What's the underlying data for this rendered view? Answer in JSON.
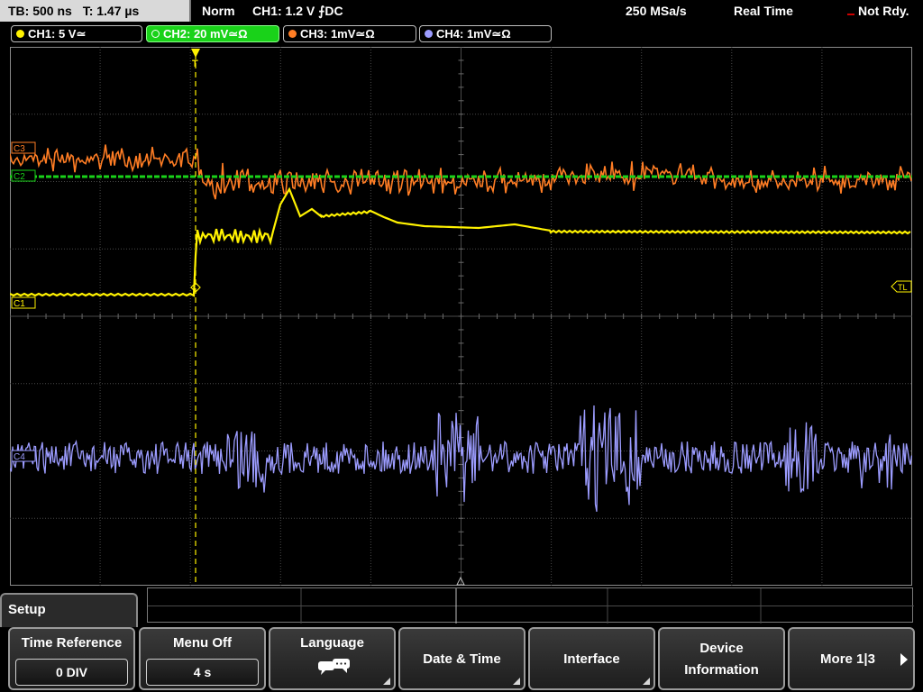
{
  "status": {
    "timebase": "TB: 500 ns",
    "trigger_time": "T: 1.47 µs",
    "acquisition": "Norm",
    "trigger_info": "CH1: 1.2 V ⨍DC",
    "sample_rate": "250 MSa/s",
    "mode": "Real Time",
    "state": "Not Rdy."
  },
  "channels": [
    {
      "label": "CH1: 5 V≃",
      "color": "#fff200"
    },
    {
      "label": "CH2: 20 mV≃Ω",
      "color": "#19d219"
    },
    {
      "label": "CH3: 1mV≃Ω",
      "color": "#ff7d24"
    },
    {
      "label": "CH4: 1mV≃Ω",
      "color": "#9c9cff"
    }
  ],
  "markers": {
    "ch1": "C1",
    "ch2": "C2",
    "ch3": "C3",
    "ch4": "C4",
    "trigger_level": "TL",
    "trigger_position": "T"
  },
  "menu": {
    "title": "Setup",
    "softkeys": [
      {
        "label": "Time Reference",
        "value": "0 DIV"
      },
      {
        "label": "Menu Off",
        "value": "4 s"
      },
      {
        "label": "Language",
        "icon": "speech-bubbles-icon"
      },
      {
        "label": "Date & Time"
      },
      {
        "label": "Interface"
      },
      {
        "label_line1": "Device",
        "label_line2": "Information"
      },
      {
        "label": "More 1|3"
      }
    ]
  }
}
